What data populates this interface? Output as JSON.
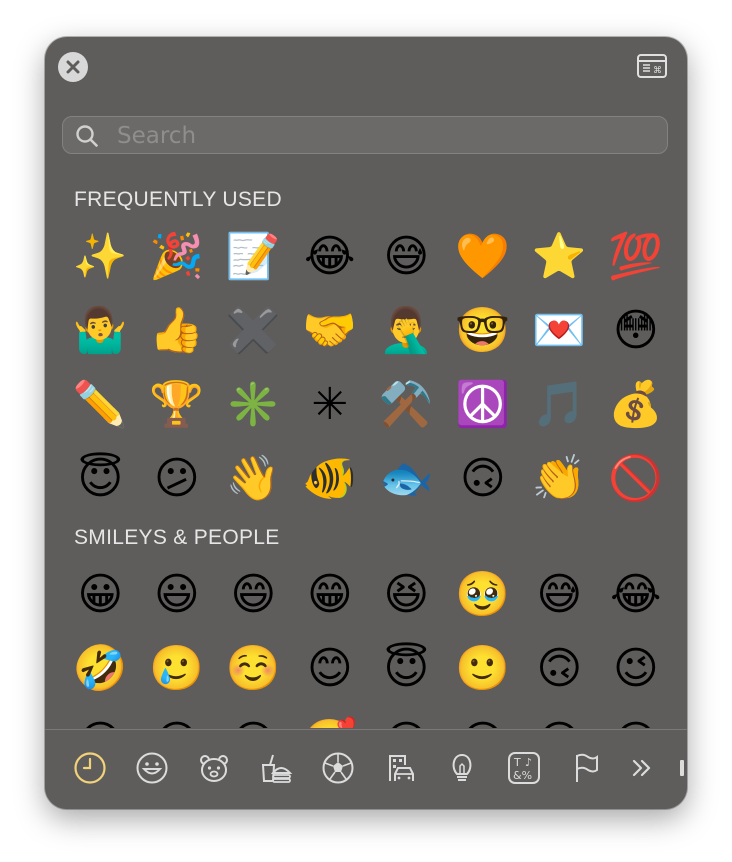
{
  "search": {
    "placeholder": "Search"
  },
  "sections": {
    "frequent": {
      "title": "FREQUENTLY USED",
      "emojis": [
        "✨",
        "🎉",
        "📝",
        "😂",
        "😅",
        "🧡",
        "⭐",
        "💯",
        "🤷‍♂️",
        "👍",
        "✖️",
        "🤝",
        "🤦‍♂️",
        "🤓",
        "💌",
        "😳",
        "✏️",
        "🏆",
        "✳️",
        "✳",
        "⚒️",
        "☮️",
        "🎵",
        "💰",
        "😇",
        "😕",
        "👋",
        "🐠",
        "🐟",
        "🙃",
        "👏",
        "🚫"
      ]
    },
    "smileys": {
      "title": "SMILEYS & PEOPLE",
      "emojis": [
        "😀",
        "😃",
        "😄",
        "😁",
        "😆",
        "🥹",
        "😅",
        "😂",
        "🤣",
        "🥲",
        "☺️",
        "😊",
        "😇",
        "🙂",
        "🙃",
        "😉",
        "😋",
        "😛",
        "😍",
        "🥰",
        "😘",
        "😗",
        "😙",
        "😚"
      ]
    }
  },
  "categories": [
    "recent",
    "smileys-people",
    "animals-nature",
    "food-drink",
    "activity",
    "travel-places",
    "objects",
    "symbols",
    "flags",
    "more"
  ],
  "colors": {
    "panel": "#5e5d5b",
    "accent": "#f2d27a",
    "icon": "#dcdcdc"
  }
}
